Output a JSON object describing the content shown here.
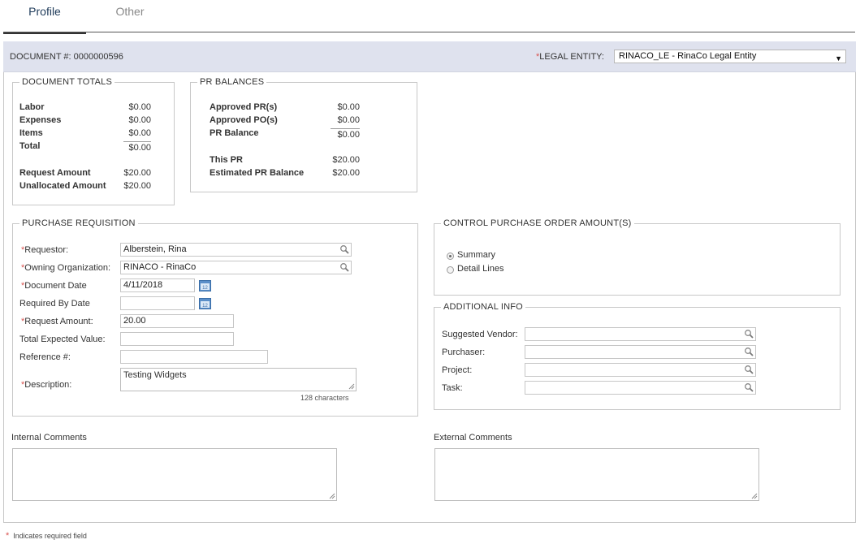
{
  "tabs": [
    {
      "label": "Profile",
      "active": true
    },
    {
      "label": "Other",
      "active": false
    }
  ],
  "header": {
    "document_label": "DOCUMENT #:",
    "document_number": "0000000596",
    "legal_entity_label": "LEGAL ENTITY:",
    "legal_entity_value": "RINACO_LE - RinaCo Legal Entity"
  },
  "document_totals": {
    "title": "DOCUMENT TOTALS",
    "labor_label": "Labor",
    "labor": "$0.00",
    "expenses_label": "Expenses",
    "expenses": "$0.00",
    "items_label": "Items",
    "items": "$0.00",
    "total_label": "Total",
    "total": "$0.00",
    "request_amount_label": "Request Amount",
    "request_amount": "$20.00",
    "unallocated_label": "Unallocated Amount",
    "unallocated": "$20.00"
  },
  "pr_balances": {
    "title": "PR BALANCES",
    "approved_pr_label": "Approved PR(s)",
    "approved_pr": "$0.00",
    "approved_po_label": "Approved PO(s)",
    "approved_po": "$0.00",
    "pr_balance_label": "PR Balance",
    "pr_balance": "$0.00",
    "this_pr_label": "This PR",
    "this_pr": "$20.00",
    "estimated_label": "Estimated PR Balance",
    "estimated": "$20.00"
  },
  "purchase_requisition": {
    "title": "PURCHASE REQUISITION",
    "requestor_label": "Requestor:",
    "requestor": "Alberstein, Rina",
    "owning_org_label": "Owning Organization:",
    "owning_org": "RINACO - RinaCo",
    "document_date_label": "Document Date",
    "document_date": "4/11/2018",
    "required_by_label": "Required By Date",
    "required_by": "",
    "request_amount_label": "Request Amount:",
    "request_amount": "20.00",
    "total_expected_label": "Total Expected Value:",
    "total_expected": "",
    "reference_label": "Reference #:",
    "reference": "",
    "description_label": "Description:",
    "description": "Testing Widgets",
    "char_count": "128 characters"
  },
  "control_po": {
    "title": "CONTROL PURCHASE ORDER AMOUNT(S)",
    "summary_label": "Summary",
    "detail_label": "Detail Lines",
    "selected": "Summary"
  },
  "additional_info": {
    "title": "ADDITIONAL INFO",
    "vendor_label": "Suggested Vendor:",
    "vendor": "",
    "purchaser_label": "Purchaser:",
    "purchaser": "",
    "project_label": "Project:",
    "project": "",
    "task_label": "Task:",
    "task": ""
  },
  "comments": {
    "internal_label": "Internal Comments",
    "external_label": "External Comments"
  },
  "footer": {
    "asterisk": "*",
    "required_note": "Indicates required field"
  },
  "icons": [
    "search-icon",
    "calendar-icon",
    "dropdown-caret-icon",
    "resize-grip-icon"
  ],
  "colors": {
    "required": "#d9534f",
    "header_bg": "#dfe2ee",
    "tab_active": "#1f3b5a"
  }
}
